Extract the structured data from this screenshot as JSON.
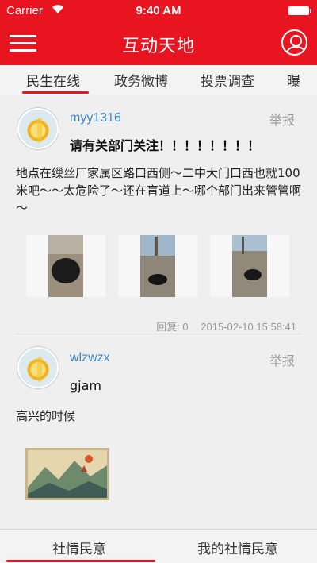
{
  "status_bar": {
    "carrier": "Carrier",
    "time": "9:40 AM"
  },
  "nav": {
    "title": "互动天地"
  },
  "tabs": [
    "民生在线",
    "政务微博",
    "投票调查",
    "曝"
  ],
  "posts": [
    {
      "username": "myy1316",
      "report": "举报",
      "title": "请有关部门关注！！！！！！！！",
      "content": "地点在缫丝厂家属区路口西侧～二中大门口西也就100米吧～～太危险了～还在盲道上～哪个部门出来管管啊～",
      "replies_label": "回复: 0",
      "timestamp": "2015-02-10 15:58:41"
    },
    {
      "username": "wlzwzx",
      "report": "举报",
      "title": "gjam",
      "content": "高兴的时候"
    }
  ],
  "bottom_tabs": [
    "社情民意",
    "我的社情民意"
  ],
  "colors": {
    "brand": "#e8141f",
    "username": "#3d88c8",
    "muted": "#999999"
  }
}
